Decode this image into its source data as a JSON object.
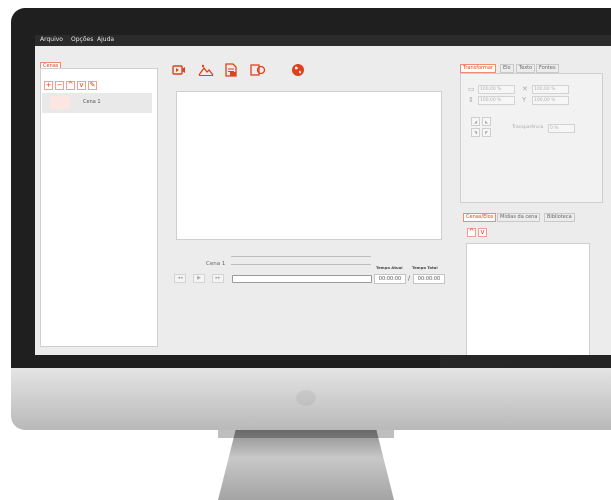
{
  "menu": {
    "items": [
      "Arquivo",
      "Opções",
      "Ajuda"
    ]
  },
  "scenes": {
    "tab_label": "Cenas",
    "buttons": [
      "+",
      "−",
      "^",
      "v",
      "✎"
    ],
    "items": [
      {
        "label": "Cena 1"
      }
    ]
  },
  "toolbar": {
    "icons": [
      "video-icon",
      "image-icon",
      "document-icon",
      "shape-icon",
      "globe-icon"
    ]
  },
  "timeline": {
    "scene_label": "Cena 1",
    "current_time_label": "Tempo Atual",
    "total_time_label": "Tempo Total",
    "current_time": "00:00:00",
    "separator": "/",
    "total_time": "00:00:00",
    "progress_percent": 0
  },
  "properties": {
    "tabs": [
      "Transformar",
      "Elo",
      "Texto",
      "Fontes"
    ],
    "active_tab": "Transformar",
    "scale_width": "100,00 %",
    "scale_height": "100,00 %",
    "pos_x": "100,00 %",
    "pos_y": "100,00 %",
    "transparency_label": "Transparência",
    "transparency_value": "0 %"
  },
  "library": {
    "tabs": [
      "Cenas/Elos",
      "Mídias da cena",
      "Biblioteca"
    ],
    "active_tab": "Cenas/Elos"
  },
  "colors": {
    "accent": "#e0401f",
    "menubar": "#2b2b2b"
  }
}
